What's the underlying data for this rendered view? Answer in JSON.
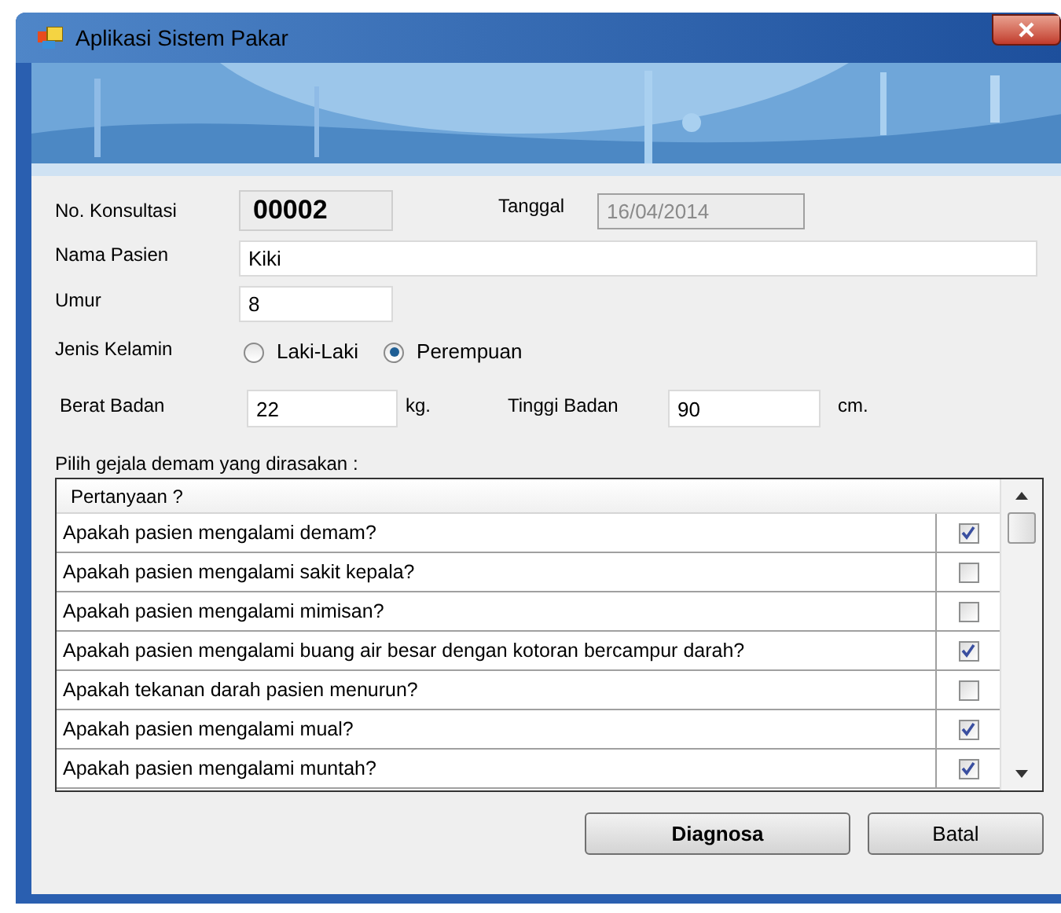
{
  "window": {
    "title": "Aplikasi Sistem Pakar"
  },
  "form": {
    "no_konsultasi": {
      "label": "No. Konsultasi",
      "value": "00002"
    },
    "tanggal": {
      "label": "Tanggal",
      "value": "16/04/2014",
      "disabled": true
    },
    "nama_pasien": {
      "label": "Nama Pasien",
      "value": "Kiki"
    },
    "umur": {
      "label": "Umur",
      "value": "8"
    },
    "jenis_kelamin": {
      "label": "Jenis Kelamin",
      "options": [
        {
          "label": "Laki-Laki",
          "selected": false
        },
        {
          "label": "Perempuan",
          "selected": true
        }
      ]
    },
    "berat_badan": {
      "label": "Berat Badan",
      "value": "22",
      "unit": "kg."
    },
    "tinggi_badan": {
      "label": "Tinggi Badan",
      "value": "90",
      "unit": "cm."
    }
  },
  "symptoms": {
    "caption": "Pilih gejala demam yang dirasakan :",
    "column_header": "Pertanyaan ?",
    "rows": [
      {
        "question": "Apakah pasien mengalami demam?",
        "checked": true
      },
      {
        "question": "Apakah pasien mengalami sakit kepala?",
        "checked": false
      },
      {
        "question": "Apakah pasien mengalami mimisan?",
        "checked": false
      },
      {
        "question": "Apakah pasien mengalami buang air besar dengan kotoran bercampur darah?",
        "checked": true
      },
      {
        "question": "Apakah tekanan darah pasien menurun?",
        "checked": false
      },
      {
        "question": "Apakah pasien mengalami mual?",
        "checked": true
      },
      {
        "question": "Apakah pasien mengalami muntah?",
        "checked": true
      }
    ]
  },
  "buttons": [
    {
      "label": "Diagnosa",
      "kind": "primary"
    },
    {
      "label": "Batal",
      "kind": "normal"
    }
  ]
}
